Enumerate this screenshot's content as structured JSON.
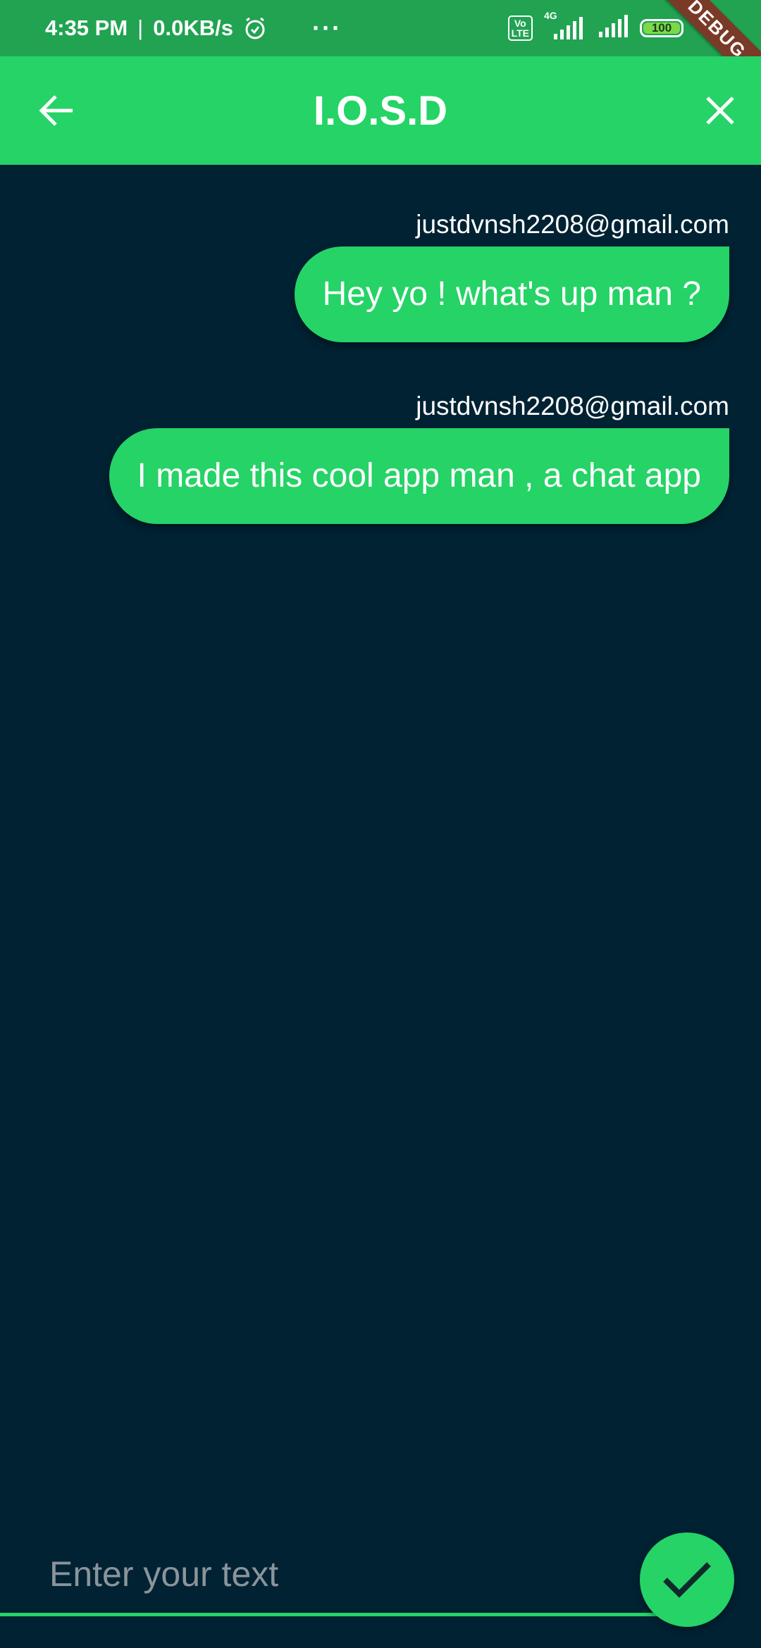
{
  "status_bar": {
    "time": "4:35 PM",
    "separator": "|",
    "speed": "0.0KB/s",
    "more": "···",
    "volte": "Vo\nLTE",
    "network": "4G",
    "battery": "100",
    "debug": "DEBUG"
  },
  "app_bar": {
    "title": "I.O.S.D"
  },
  "messages": [
    {
      "sender": "justdvnsh2208@gmail.com",
      "text": "Hey yo ! what's up man ?"
    },
    {
      "sender": "justdvnsh2208@gmail.com",
      "text": "I made this cool app man , a chat app"
    }
  ],
  "input": {
    "placeholder": "Enter your text",
    "value": ""
  },
  "colors": {
    "status_bar": "#21a352",
    "accent": "#25d366",
    "background": "#012233"
  },
  "icons": {
    "back": "arrow-back-icon",
    "close": "close-icon",
    "send": "checkmark-icon"
  }
}
